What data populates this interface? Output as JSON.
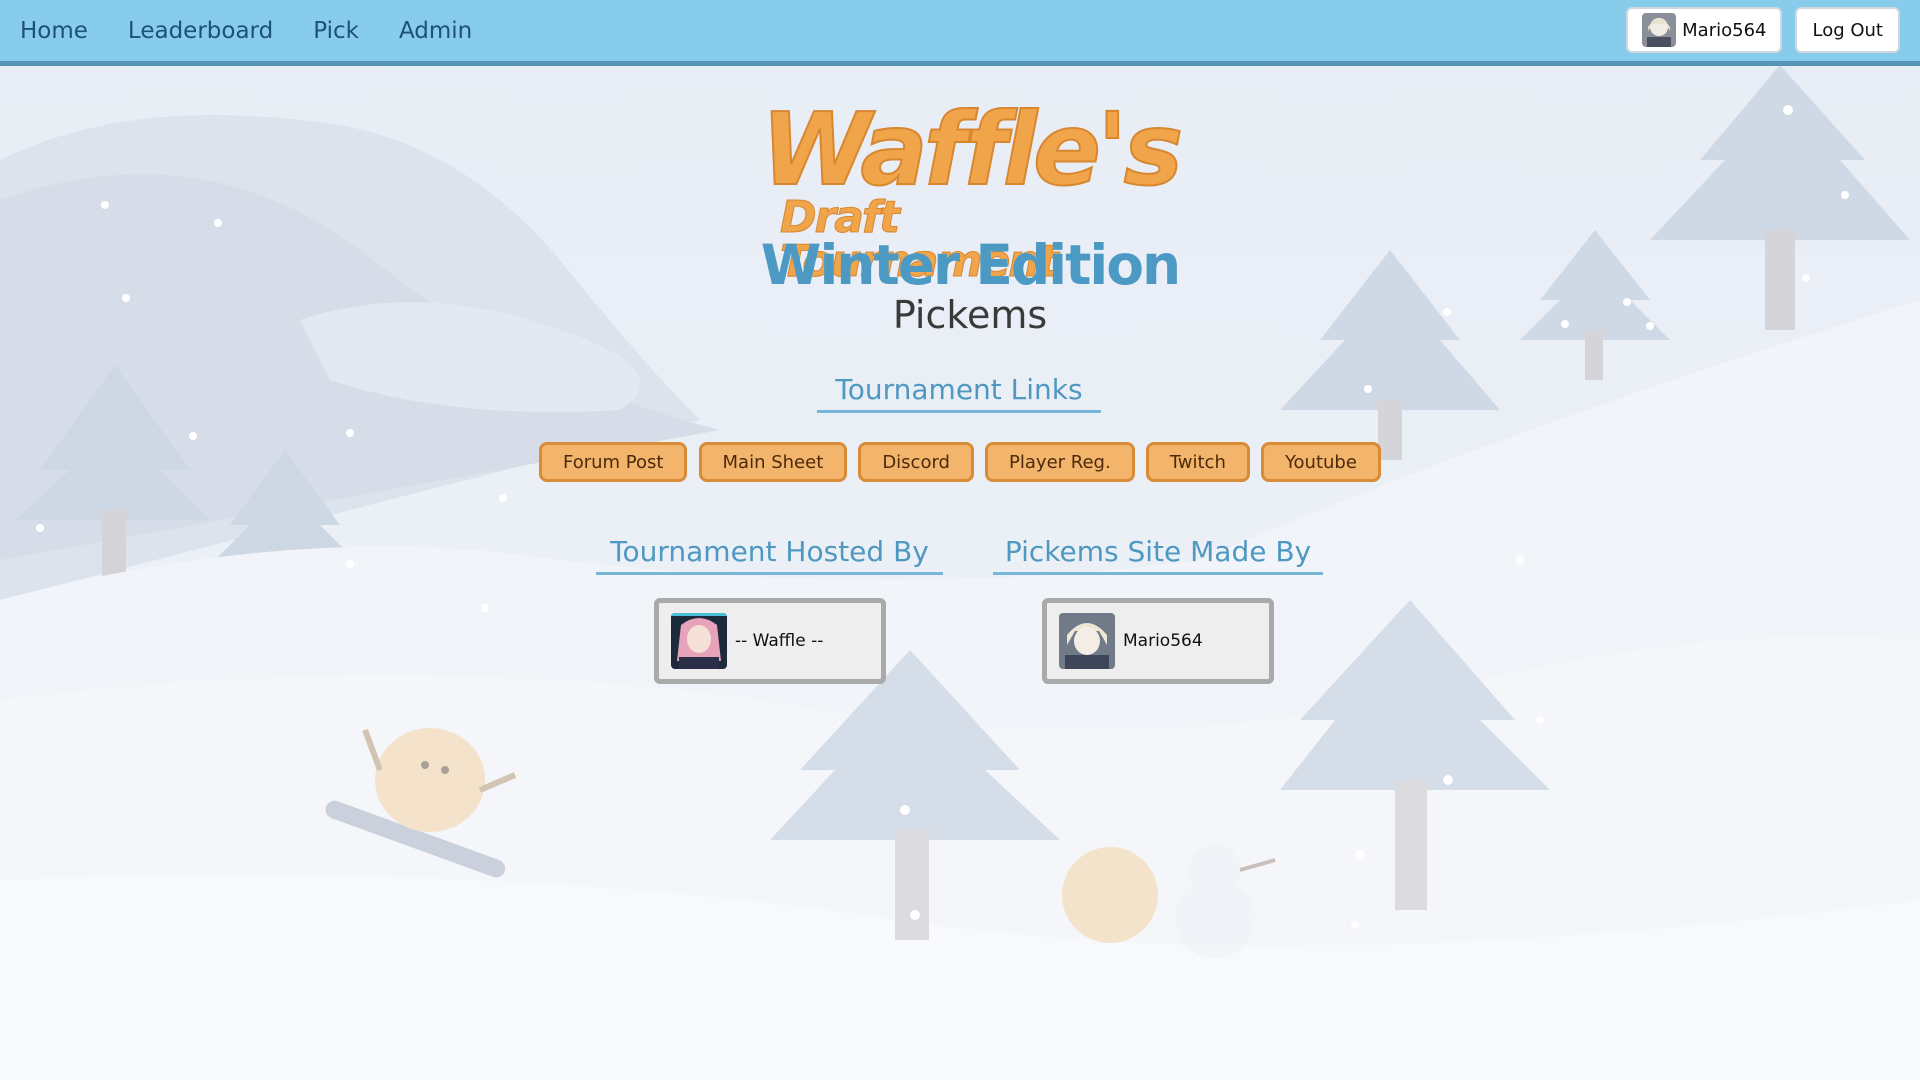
{
  "nav": {
    "links": [
      "Home",
      "Leaderboard",
      "Pick",
      "Admin"
    ],
    "user": {
      "name": "Mario564"
    },
    "logout_label": "Log Out"
  },
  "logo": {
    "line1": "Waffle's",
    "line2": "Draft Tournament",
    "line3": "Winter Edition",
    "line4": "Pickems"
  },
  "tournament_links": {
    "heading": "Tournament Links",
    "buttons": [
      "Forum Post",
      "Main Sheet",
      "Discord",
      "Player Reg.",
      "Twitch",
      "Youtube"
    ]
  },
  "hosted_by": {
    "heading": "Tournament Hosted By",
    "name": "-- Waffle --"
  },
  "made_by": {
    "heading": "Pickems Site Made By",
    "name": "Mario564"
  },
  "colors": {
    "nav_bg": "#87cceb",
    "nav_border": "#5594b7",
    "accent_orange": "#f0a54a",
    "accent_blue": "#4c9ac4",
    "button_bg": "#f2b56b"
  }
}
